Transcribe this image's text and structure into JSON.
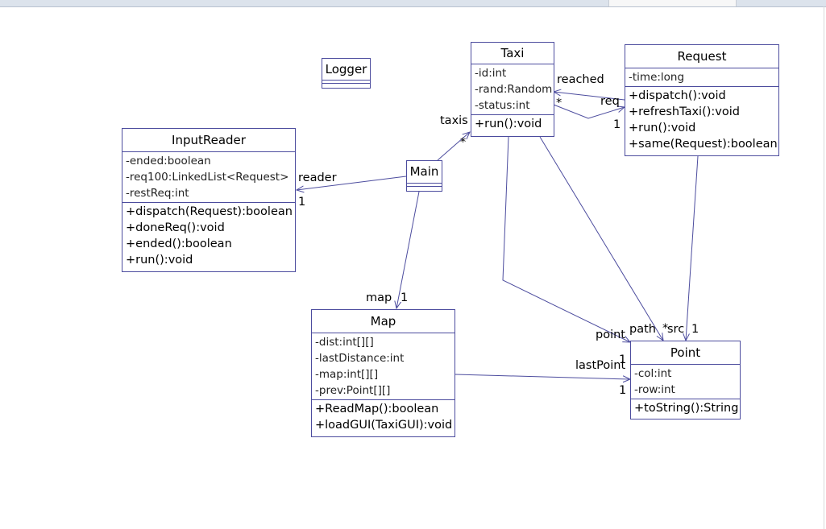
{
  "classes": {
    "logger": {
      "name": "Logger"
    },
    "taxi": {
      "name": "Taxi",
      "attrs": [
        "-id:int",
        "-rand:Random",
        "-status:int"
      ],
      "ops": [
        "+run():void"
      ]
    },
    "request": {
      "name": "Request",
      "attrs": [
        "-time:long"
      ],
      "ops": [
        "+dispatch():void",
        "+refreshTaxi():void",
        "+run():void",
        "+same(Request):boolean"
      ]
    },
    "inputreader": {
      "name": "InputReader",
      "attrs": [
        "-ended:boolean",
        "-req100:LinkedList<Request>",
        "-restReq:int"
      ],
      "ops": [
        "+dispatch(Request):boolean",
        "+doneReq():void",
        "+ended():boolean",
        "+run():void"
      ]
    },
    "main": {
      "name": "Main"
    },
    "map": {
      "name": "Map",
      "attrs": [
        "-dist:int[][]",
        "-lastDistance:int",
        "-map:int[][]",
        "-prev:Point[][]"
      ],
      "ops": [
        "+ReadMap():boolean",
        "+loadGUI(TaxiGUI):void"
      ]
    },
    "point": {
      "name": "Point",
      "attrs": [
        "-col:int",
        "-row:int"
      ],
      "ops": [
        "+toString():String"
      ]
    }
  },
  "labels": {
    "reached": "reached",
    "req": "req",
    "req_star": "*",
    "req_one": "1",
    "taxis": "taxis",
    "taxis_star": "*",
    "reader": "reader",
    "reader_one": "1",
    "map": "map",
    "map_one": "1",
    "point": "point",
    "point_one": "1",
    "path": "path",
    "path_star": "*",
    "src": "src",
    "src_one": "1",
    "lastPoint": "lastPoint",
    "lastPoint_one": "1"
  },
  "colors": {
    "line": "#4c4c9e",
    "border": "#4c4c9e"
  }
}
